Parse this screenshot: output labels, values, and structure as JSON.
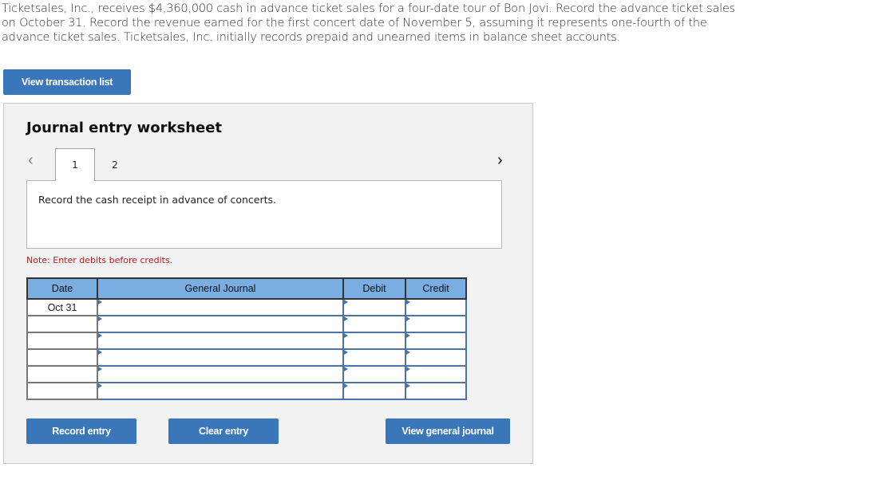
{
  "problem_text": "Ticketsales, Inc., receives $4,360,000 cash in advance ticket sales for a four-date tour of Bon Jovi. Record the advance ticket sales on October 31. Record the revenue earned for the first concert date of November 5, assuming it represents one-fourth of the advance ticket sales. Ticketsales, Inc. initially records prepaid and unearned items in balance sheet accounts.",
  "buttons": {
    "view_transaction_list": "View transaction list",
    "record_entry": "Record entry",
    "clear_entry": "Clear entry",
    "view_general_journal": "View general journal"
  },
  "worksheet": {
    "title": "Journal entry worksheet",
    "nav_prev_icon": "‹",
    "nav_next_icon": "›",
    "tabs": [
      {
        "label": "1",
        "active": true
      },
      {
        "label": "2",
        "active": false
      }
    ],
    "instruction": "Record the cash receipt in advance of concerts.",
    "note": "Note: Enter debits before credits."
  },
  "journal": {
    "headers": {
      "date": "Date",
      "general_journal": "General Journal",
      "debit": "Debit",
      "credit": "Credit"
    },
    "rows": [
      {
        "date": "Oct 31",
        "account": "",
        "debit": "",
        "credit": ""
      },
      {
        "date": "",
        "account": "",
        "debit": "",
        "credit": ""
      },
      {
        "date": "",
        "account": "",
        "debit": "",
        "credit": ""
      },
      {
        "date": "",
        "account": "",
        "debit": "",
        "credit": ""
      },
      {
        "date": "",
        "account": "",
        "debit": "",
        "credit": ""
      },
      {
        "date": "",
        "account": "",
        "debit": "",
        "credit": ""
      }
    ]
  },
  "colors": {
    "button": "#3a76ba",
    "header": "#7aaee3",
    "note": "#b22222",
    "panel": "#f2f2f2"
  }
}
